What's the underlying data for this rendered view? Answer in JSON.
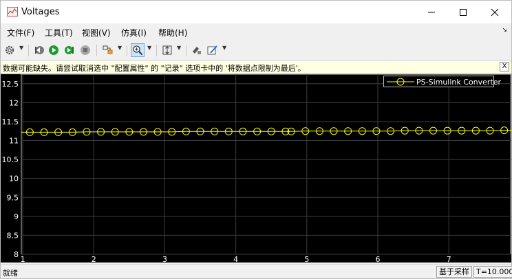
{
  "window": {
    "title": "Voltages",
    "minimize_icon": "minimize-icon",
    "maximize_icon": "maximize-icon",
    "close_icon": "close-icon"
  },
  "menu": {
    "items": [
      {
        "label": "文件(F)"
      },
      {
        "label": "工具(T)"
      },
      {
        "label": "视图(V)"
      },
      {
        "label": "仿真(I)"
      },
      {
        "label": "帮助(H)"
      }
    ]
  },
  "toolbar": {
    "icons": [
      "settings-icon",
      "step-back-icon",
      "run-icon",
      "step-forward-icon",
      "stop-icon",
      "highlight-icon",
      "zoom-in-icon",
      "autoscale-icon",
      "save-axes-icon",
      "style-icon"
    ]
  },
  "infobar": {
    "message": "数据可能缺失。请尝试取消选中 \"配置属性\" 的 \"记录\" 选项卡中的 '将数据点限制为最后'。",
    "close_label": "X"
  },
  "legend": {
    "label": "PS-Simulink Converter",
    "color": "#ffff00"
  },
  "status": {
    "left": "就绪",
    "sampling": "基于采样",
    "time": "T=10.000"
  },
  "chart_data": {
    "type": "line",
    "xlim": [
      0.98,
      7.88
    ],
    "ylim": [
      8.0,
      12.75
    ],
    "xticks": [
      1,
      2,
      3,
      4,
      5,
      6,
      7
    ],
    "yticks": [
      8,
      8.5,
      9,
      9.5,
      10,
      10.5,
      11,
      11.5,
      12,
      12.5
    ],
    "grid": true,
    "background": "#000000",
    "series": [
      {
        "name": "PS-Simulink Converter",
        "color": "#ffff00",
        "x": [
          1.1,
          1.3,
          1.5,
          1.7,
          1.9,
          2.1,
          2.3,
          2.5,
          2.7,
          2.9,
          3.1,
          3.3,
          3.5,
          3.7,
          3.9,
          4.1,
          4.3,
          4.5,
          4.7,
          4.78,
          4.98,
          5.18,
          5.38,
          5.58,
          5.78,
          5.98,
          6.18,
          6.38,
          6.58,
          6.78,
          6.98,
          7.18,
          7.38,
          7.58,
          7.78
        ],
        "y": [
          11.22,
          11.22,
          11.22,
          11.22,
          11.23,
          11.23,
          11.23,
          11.23,
          11.23,
          11.23,
          11.23,
          11.24,
          11.24,
          11.24,
          11.24,
          11.24,
          11.24,
          11.24,
          11.24,
          11.24,
          11.25,
          11.25,
          11.25,
          11.25,
          11.25,
          11.25,
          11.25,
          11.26,
          11.26,
          11.26,
          11.26,
          11.26,
          11.26,
          11.26,
          11.27
        ]
      }
    ]
  }
}
